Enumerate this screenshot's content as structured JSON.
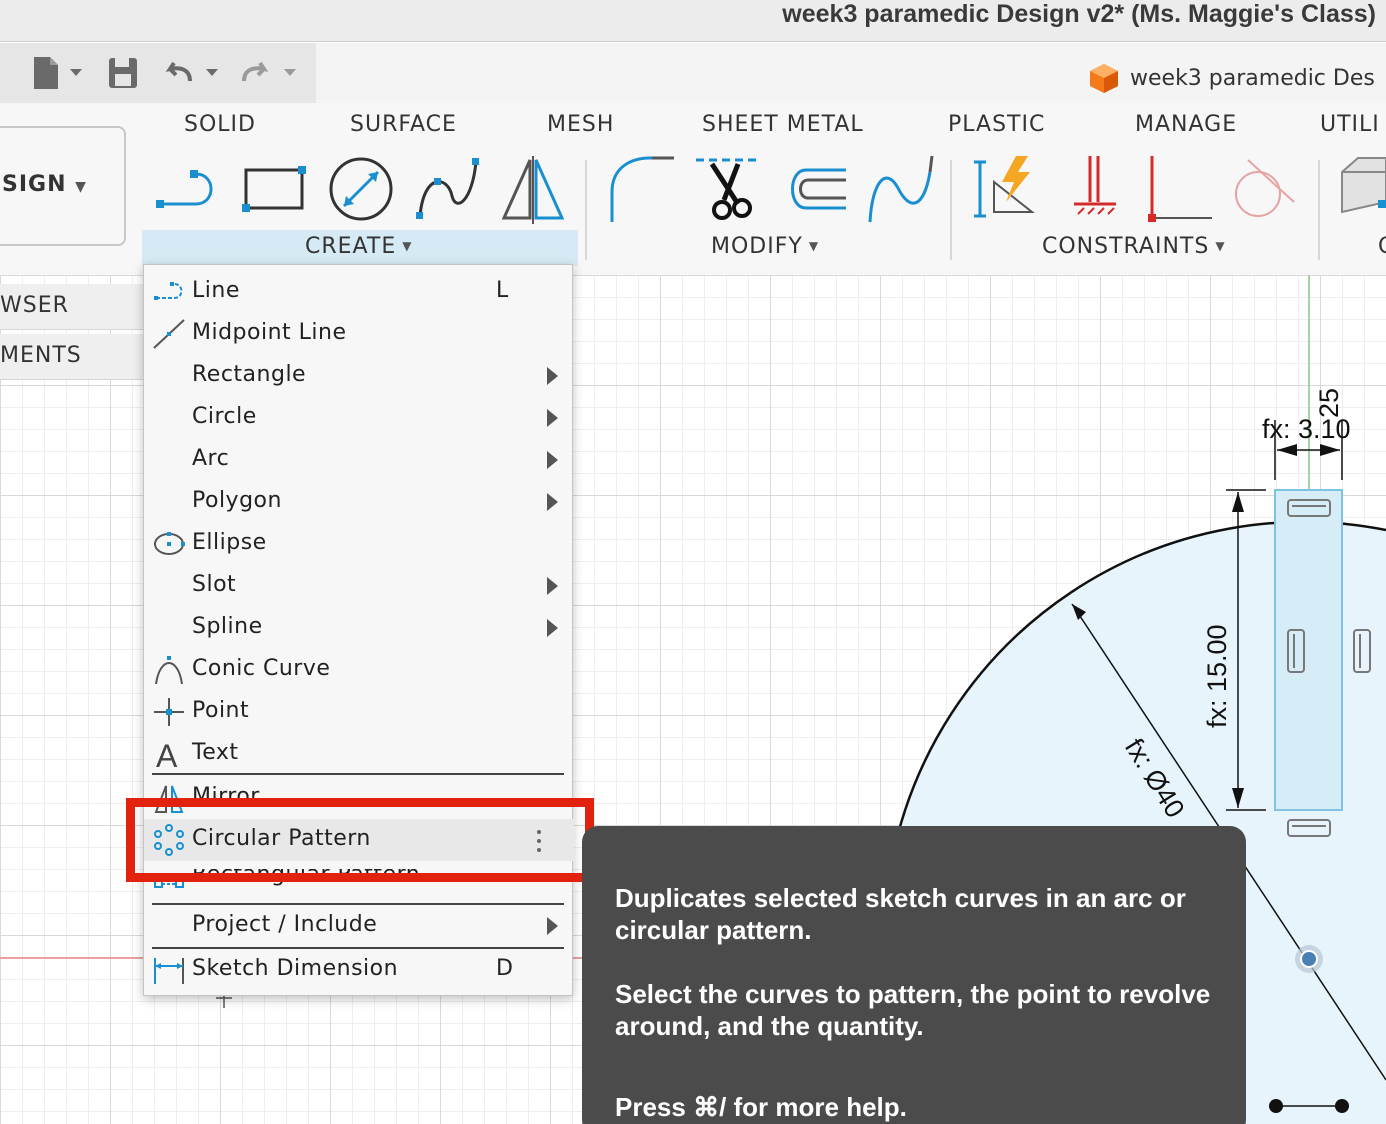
{
  "window": {
    "title": "week3 paramedic Design v2* (Ms. Maggie's Class)"
  },
  "document_tab": {
    "label": "week3 paramedic Des"
  },
  "workspace": {
    "label": "SIGN"
  },
  "tabs": [
    "SOLID",
    "SURFACE",
    "MESH",
    "SHEET METAL",
    "PLASTIC",
    "MANAGE",
    "UTILI"
  ],
  "groups": {
    "create": "CREATE",
    "modify": "MODIFY",
    "constraints": "CONSTRAINTS",
    "partial": "C"
  },
  "browser": {
    "row1": "WSER",
    "row2": "MENTS"
  },
  "menu": {
    "items": [
      {
        "label": "Line",
        "shortcut": "L"
      },
      {
        "label": "Midpoint Line"
      },
      {
        "label": "Rectangle"
      },
      {
        "label": "Circle"
      },
      {
        "label": "Arc"
      },
      {
        "label": "Polygon"
      },
      {
        "label": "Ellipse"
      },
      {
        "label": "Slot"
      },
      {
        "label": "Spline"
      },
      {
        "label": "Conic Curve"
      },
      {
        "label": "Point"
      },
      {
        "label": "Text"
      },
      {
        "label": "Mirror"
      },
      {
        "label": "Circular Pattern"
      },
      {
        "label": "Rectangular Pattern"
      },
      {
        "label": "Project / Include"
      },
      {
        "label": "Sketch Dimension",
        "shortcut": "D"
      }
    ]
  },
  "tooltip": {
    "line1": "Duplicates selected sketch curves in an arc or circular pattern.",
    "line2": "Select the curves to pattern, the point to revolve around, and the quantity.",
    "line3": "Press ⌘/ for more help."
  },
  "dimensions": {
    "width": "fx: 3.10",
    "top": "25",
    "height": "fx: 15.00",
    "diameter": "fx: Ø40"
  },
  "colors": {
    "accent_blue": "#1a8fd0",
    "highlight_red": "#e0220e",
    "constraint_red": "#d42a2a",
    "tooltip_bg": "#4b4b4b"
  }
}
